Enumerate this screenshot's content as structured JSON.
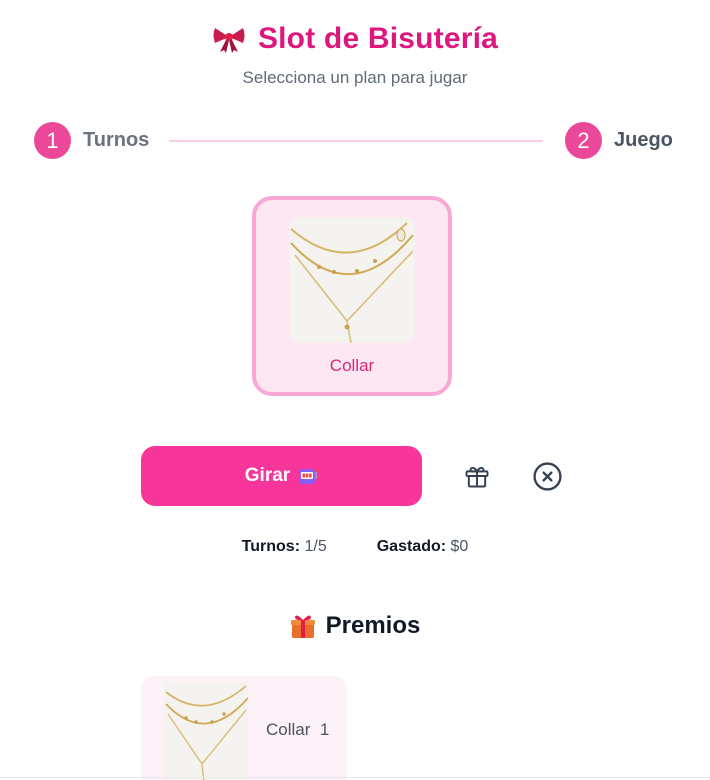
{
  "header": {
    "title": "Slot de Bisutería",
    "title_icon": "ribbon-bow-icon",
    "subtitle": "Selecciona un plan para jugar"
  },
  "stepper": {
    "steps": [
      {
        "number": "1",
        "label": "Turnos"
      },
      {
        "number": "2",
        "label": "Juego"
      }
    ]
  },
  "slot": {
    "item_label": "Collar",
    "item_image": "necklace-image"
  },
  "controls": {
    "spin_label": "Girar",
    "spin_icon": "slot-machine-icon",
    "gift_icon": "gift-icon",
    "close_icon": "close-circle-icon"
  },
  "stats": {
    "turns_label": "Turnos:",
    "turns_value": "1/5",
    "spent_label": "Gastado:",
    "spent_value": "$0"
  },
  "prizes": {
    "title": "Premios",
    "title_icon": "wrapped-gift-icon",
    "items": [
      {
        "name": "Collar",
        "count": "1"
      }
    ]
  },
  "colors": {
    "accent": "#ec4899",
    "title": "#de177f",
    "button": "#f7359b",
    "card_bg": "#fce7f3",
    "card_border": "#f9a8d4"
  }
}
